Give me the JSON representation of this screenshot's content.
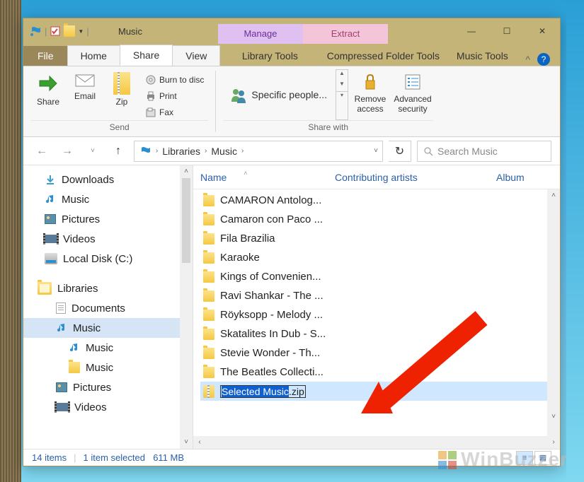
{
  "window": {
    "title": "Music",
    "context_tabs": [
      {
        "label": "Manage"
      },
      {
        "label": "Extract"
      }
    ],
    "controls": {
      "min": "—",
      "max": "☐",
      "close": "✕"
    }
  },
  "tabs": {
    "file": "File",
    "items": [
      {
        "label": "Home"
      },
      {
        "label": "Share",
        "active": true
      },
      {
        "label": "View"
      }
    ],
    "under": [
      {
        "label": "Library Tools"
      },
      {
        "label": "Compressed Folder Tools"
      },
      {
        "label": "Music Tools"
      }
    ],
    "collapse": "^"
  },
  "ribbon": {
    "send": {
      "label": "Send",
      "share": "Share",
      "email": "Email",
      "zip": "Zip",
      "burn": "Burn to disc",
      "print": "Print",
      "fax": "Fax"
    },
    "sharewith": {
      "label": "Share with",
      "specific": "Specific people...",
      "remove": "Remove access",
      "advanced": "Advanced security"
    }
  },
  "address": {
    "crumbs": [
      "Libraries",
      "Music"
    ],
    "search_placeholder": "Search Music"
  },
  "nav": {
    "top": [
      {
        "label": "Downloads",
        "icon": "download"
      },
      {
        "label": "Music",
        "icon": "music"
      },
      {
        "label": "Pictures",
        "icon": "picture"
      },
      {
        "label": "Videos",
        "icon": "video"
      },
      {
        "label": "Local Disk (C:)",
        "icon": "disk"
      }
    ],
    "libraries": {
      "label": "Libraries",
      "items": [
        {
          "label": "Documents",
          "icon": "doc"
        },
        {
          "label": "Music",
          "icon": "music",
          "sel": true,
          "children": [
            {
              "label": "Music",
              "icon": "music"
            },
            {
              "label": "Music",
              "icon": "folder"
            }
          ]
        },
        {
          "label": "Pictures",
          "icon": "picture"
        },
        {
          "label": "Videos",
          "icon": "video"
        }
      ]
    }
  },
  "columns": {
    "name": "Name",
    "contrib": "Contributing artists",
    "album": "Album"
  },
  "files": [
    {
      "name": "CAMARON Antolog...",
      "type": "folder"
    },
    {
      "name": "Camaron con Paco ...",
      "type": "folder"
    },
    {
      "name": "Fila Brazilia",
      "type": "folder"
    },
    {
      "name": "Karaoke",
      "type": "folder"
    },
    {
      "name": "Kings of Convenien...",
      "type": "folder"
    },
    {
      "name": "Ravi Shankar - The ...",
      "type": "folder"
    },
    {
      "name": "Röyksopp - Melody ...",
      "type": "folder"
    },
    {
      "name": "Skatalites In Dub - S...",
      "type": "folder"
    },
    {
      "name": "Stevie Wonder - Th...",
      "type": "folder"
    },
    {
      "name": "The Beatles Collecti...",
      "type": "folder"
    }
  ],
  "editing": {
    "selected": "Selected Music",
    "ext": ".zip"
  },
  "status": {
    "count": "14 items",
    "sel": "1 item selected",
    "size": "611 MB"
  },
  "watermark": "WinBuzzer"
}
